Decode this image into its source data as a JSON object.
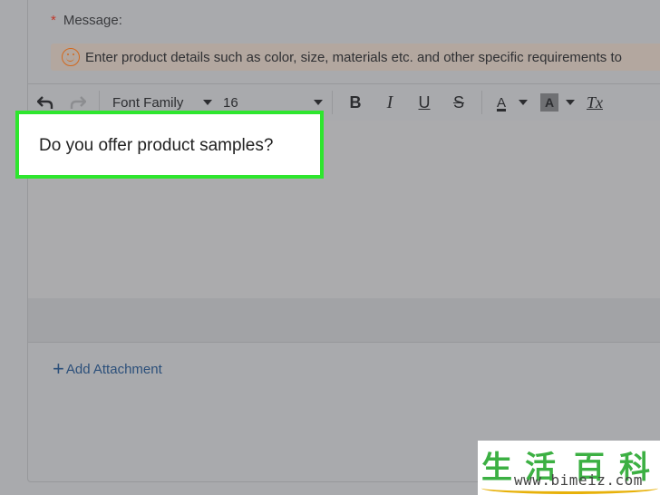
{
  "form": {
    "required_mark": "*",
    "message_label": "Message:",
    "hint_text": "Enter product details such as color, size, materials etc. and other specific requirements to",
    "hint_icon": "smile-icon"
  },
  "toolbar": {
    "undo_icon": "undo-icon",
    "redo_icon": "redo-icon",
    "font_family_label": "Font Family",
    "font_size_value": "16",
    "bold_label": "B",
    "italic_label": "I",
    "underline_label": "U",
    "strike_label": "S",
    "text_color_label": "A",
    "highlight_label": "A",
    "clear_format_label": "Tx"
  },
  "editor": {
    "content": "Do you offer product samples?"
  },
  "attachment": {
    "label": "Add Attachment"
  },
  "watermark": {
    "chars": [
      "生",
      "活",
      "百",
      "科"
    ],
    "url": "www.bimeiz.com"
  },
  "colors": {
    "highlight_border": "#2ee62e",
    "link": "#2b4f7a",
    "required": "#c0392b"
  }
}
